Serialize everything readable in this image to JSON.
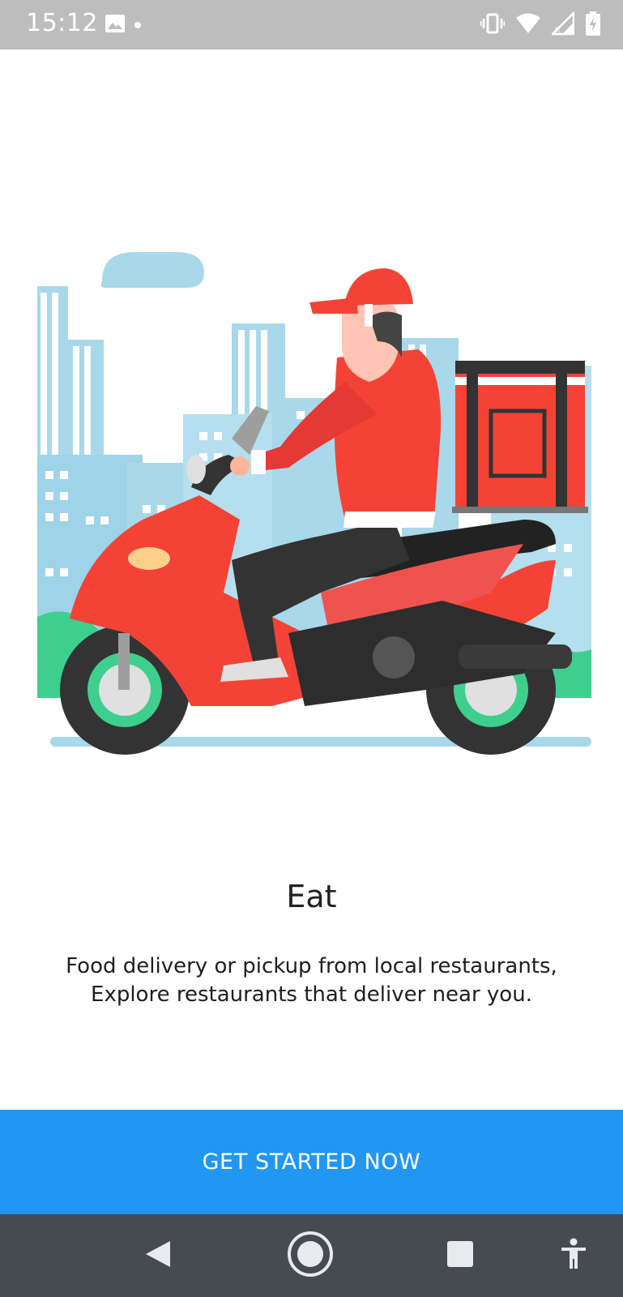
{
  "status_bar": {
    "time": "15:12",
    "icons": [
      "image-icon",
      "dot-icon",
      "vibrate-icon",
      "wifi-icon",
      "signal-icon",
      "battery-icon"
    ]
  },
  "onboarding": {
    "illustration": "delivery-scooter-illustration",
    "title": "Eat",
    "description_line1": "Food delivery or pickup from local restaurants,",
    "description_line2": "Explore restaurants that deliver near you."
  },
  "cta": {
    "label": "GET STARTED NOW",
    "color": "#2196f3"
  },
  "nav_bar": {
    "buttons": [
      "back-icon",
      "home-icon",
      "recents-icon",
      "accessibility-icon"
    ]
  }
}
